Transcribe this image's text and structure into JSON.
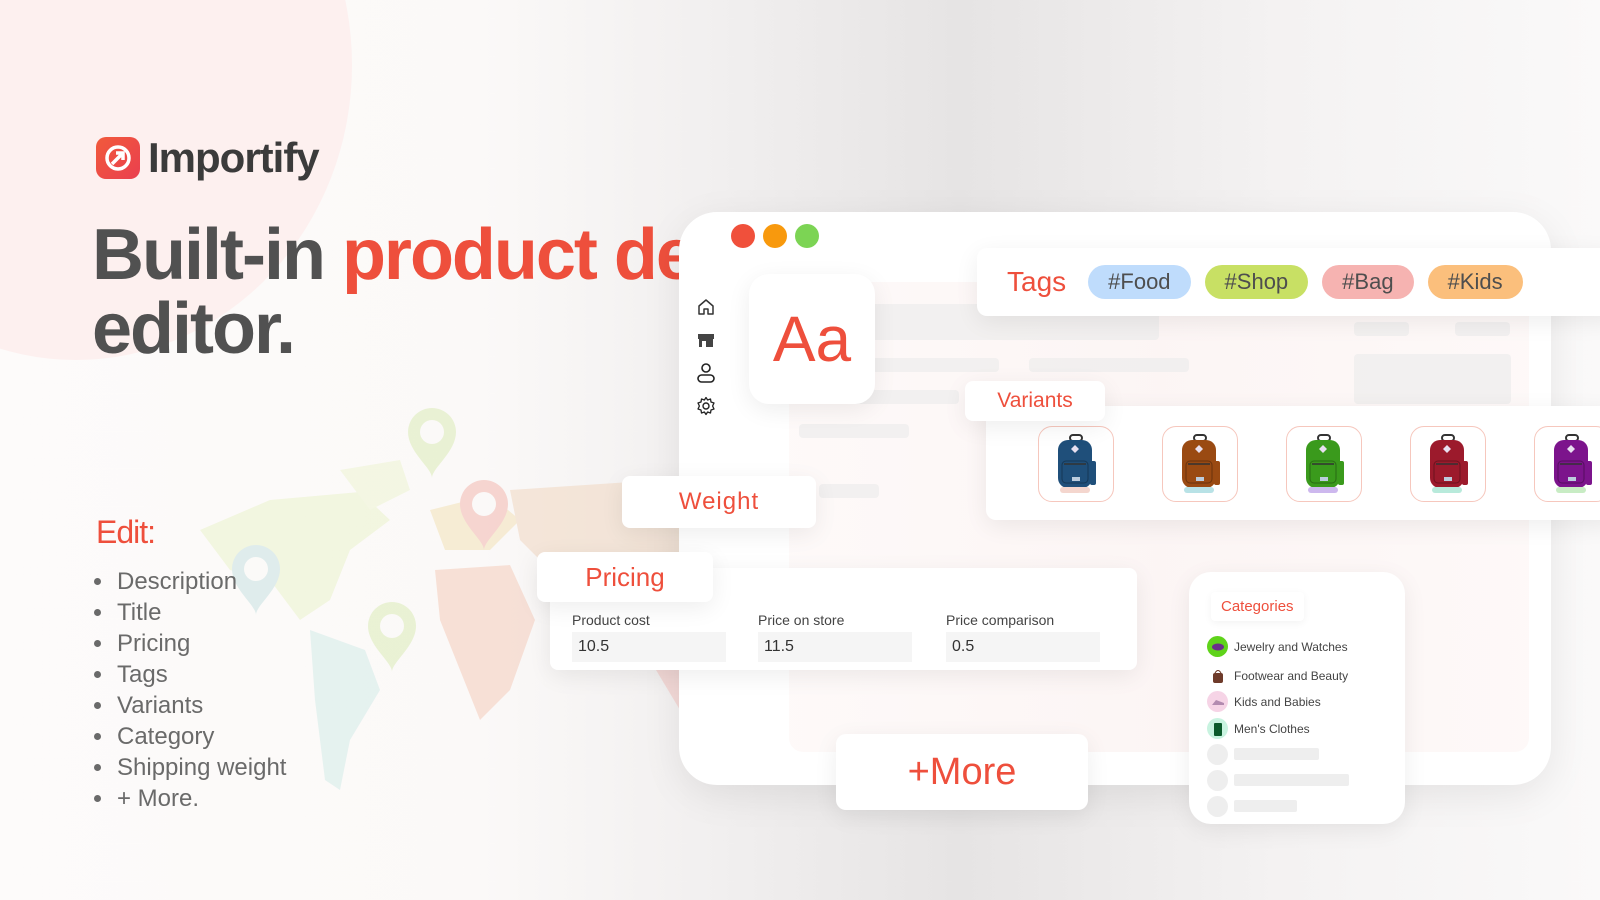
{
  "brand": {
    "name": "Importify",
    "logo_icon": "arrow-circle-icon",
    "color": "#ee4f3c"
  },
  "headline": {
    "part1": "Built-in ",
    "accent": "product description",
    "part2": "editor."
  },
  "edit": {
    "title": "Edit:",
    "items": [
      "Description",
      "Title",
      "Pricing",
      "Tags",
      "Variants",
      "Category",
      "Shipping weight",
      "+ More."
    ]
  },
  "window": {
    "traffic_lights": [
      "#f0503b",
      "#f8990d",
      "#7cd454"
    ],
    "sidebar": [
      {
        "icon": "home-icon"
      },
      {
        "icon": "store-icon"
      },
      {
        "icon": "user-icon"
      },
      {
        "icon": "gear-icon"
      }
    ]
  },
  "font_card": {
    "label": "Aa"
  },
  "tags": {
    "label": "Tags",
    "items": [
      {
        "text": "#Food",
        "color": "#bfdcfc"
      },
      {
        "text": "#Shop",
        "color": "#c8e064"
      },
      {
        "text": "#Bag",
        "color": "#f6b3b1"
      },
      {
        "text": "#Kids",
        "color": "#fbbf7c"
      }
    ]
  },
  "variants": {
    "label": "Variants",
    "items": [
      {
        "name": "backpack-blue",
        "color": "#1f4f7a",
        "base": "#f4d6ce"
      },
      {
        "name": "backpack-brown",
        "color": "#9a4a12",
        "base": "#b8e2e6"
      },
      {
        "name": "backpack-green",
        "color": "#3a9a1c",
        "base": "#cdb8ee"
      },
      {
        "name": "backpack-red",
        "color": "#9c1a2c",
        "base": "#b8eadb"
      },
      {
        "name": "backpack-purple",
        "color": "#7c148c",
        "base": "#c8ecc4"
      }
    ]
  },
  "weight": {
    "label": "Weight"
  },
  "pricing": {
    "label": "Pricing",
    "fields": [
      {
        "label": "Product cost",
        "value": "10.5"
      },
      {
        "label": "Price on store",
        "value": "11.5"
      },
      {
        "label": "Price comparison",
        "value": "0.5"
      }
    ]
  },
  "categories": {
    "label": "Categories",
    "items": [
      {
        "text": "Jewelry and Watches",
        "icon": "watch-icon",
        "bg": "#5fd31a"
      },
      {
        "text": "Footwear and Beauty",
        "icon": "bag-icon",
        "bg": "#ffffff"
      },
      {
        "text": "Kids and Babies",
        "icon": "shoe-icon",
        "bg": "#f6d4e6"
      },
      {
        "text": "Men's Clothes",
        "icon": "shirt-icon",
        "bg": "#c8f3e0"
      }
    ]
  },
  "more": {
    "label": "+More"
  }
}
